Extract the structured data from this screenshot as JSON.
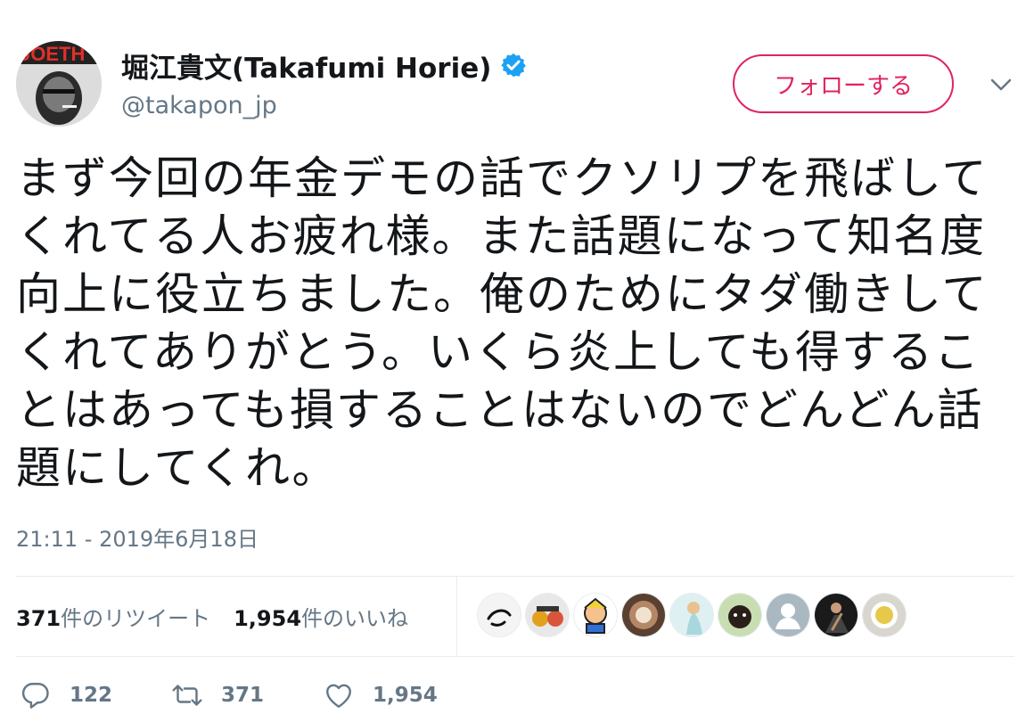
{
  "user": {
    "display_name": "堀江貴文(Takafumi Horie)",
    "handle": "@takapon_jp",
    "avatar_text": "JOETH"
  },
  "follow_label": "フォローする",
  "tweet": {
    "text": "まず今回の年金デモの話でクソリプを飛ばしてくれてる人お疲れ様。また話題になって知名度向上に役立ちました。俺のためにタダ働きしてくれてありがとう。いくら炎上しても得することはあっても損することはないのでどんどん話題にしてくれ。",
    "timestamp": "21:11 - 2019年6月18日"
  },
  "stats": {
    "retweets_count": "371",
    "retweets_label": "件のリツイート",
    "likes_count": "1,954",
    "likes_label": "件のいいね"
  },
  "actions": {
    "reply_count": "122",
    "retweet_count": "371",
    "like_count": "1,954"
  },
  "colors": {
    "follow": "#e0245e",
    "verified": "#1da1f2",
    "secondary_text": "#657786"
  },
  "icons": [
    "verified-icon",
    "chevron-down-icon",
    "reply-icon",
    "retweet-icon",
    "heart-icon"
  ]
}
